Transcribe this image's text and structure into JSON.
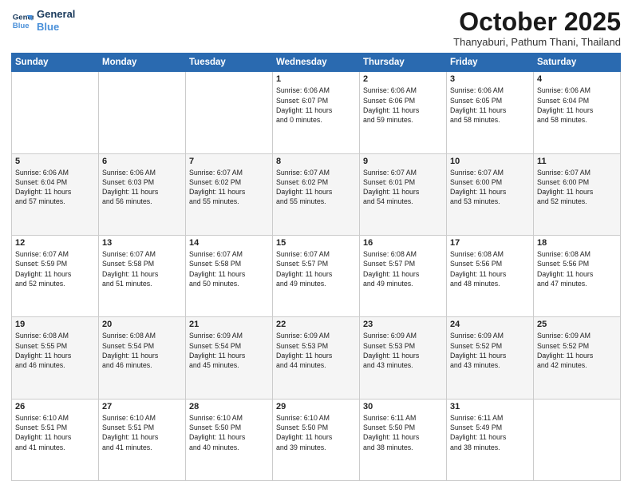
{
  "logo": {
    "line1": "General",
    "line2": "Blue"
  },
  "title": "October 2025",
  "location": "Thanyaburi, Pathum Thani, Thailand",
  "weekdays": [
    "Sunday",
    "Monday",
    "Tuesday",
    "Wednesday",
    "Thursday",
    "Friday",
    "Saturday"
  ],
  "weeks": [
    [
      {
        "day": "",
        "info": ""
      },
      {
        "day": "",
        "info": ""
      },
      {
        "day": "",
        "info": ""
      },
      {
        "day": "1",
        "info": "Sunrise: 6:06 AM\nSunset: 6:07 PM\nDaylight: 11 hours\nand 0 minutes."
      },
      {
        "day": "2",
        "info": "Sunrise: 6:06 AM\nSunset: 6:06 PM\nDaylight: 11 hours\nand 59 minutes."
      },
      {
        "day": "3",
        "info": "Sunrise: 6:06 AM\nSunset: 6:05 PM\nDaylight: 11 hours\nand 58 minutes."
      },
      {
        "day": "4",
        "info": "Sunrise: 6:06 AM\nSunset: 6:04 PM\nDaylight: 11 hours\nand 58 minutes."
      }
    ],
    [
      {
        "day": "5",
        "info": "Sunrise: 6:06 AM\nSunset: 6:04 PM\nDaylight: 11 hours\nand 57 minutes."
      },
      {
        "day": "6",
        "info": "Sunrise: 6:06 AM\nSunset: 6:03 PM\nDaylight: 11 hours\nand 56 minutes."
      },
      {
        "day": "7",
        "info": "Sunrise: 6:07 AM\nSunset: 6:02 PM\nDaylight: 11 hours\nand 55 minutes."
      },
      {
        "day": "8",
        "info": "Sunrise: 6:07 AM\nSunset: 6:02 PM\nDaylight: 11 hours\nand 55 minutes."
      },
      {
        "day": "9",
        "info": "Sunrise: 6:07 AM\nSunset: 6:01 PM\nDaylight: 11 hours\nand 54 minutes."
      },
      {
        "day": "10",
        "info": "Sunrise: 6:07 AM\nSunset: 6:00 PM\nDaylight: 11 hours\nand 53 minutes."
      },
      {
        "day": "11",
        "info": "Sunrise: 6:07 AM\nSunset: 6:00 PM\nDaylight: 11 hours\nand 52 minutes."
      }
    ],
    [
      {
        "day": "12",
        "info": "Sunrise: 6:07 AM\nSunset: 5:59 PM\nDaylight: 11 hours\nand 52 minutes."
      },
      {
        "day": "13",
        "info": "Sunrise: 6:07 AM\nSunset: 5:58 PM\nDaylight: 11 hours\nand 51 minutes."
      },
      {
        "day": "14",
        "info": "Sunrise: 6:07 AM\nSunset: 5:58 PM\nDaylight: 11 hours\nand 50 minutes."
      },
      {
        "day": "15",
        "info": "Sunrise: 6:07 AM\nSunset: 5:57 PM\nDaylight: 11 hours\nand 49 minutes."
      },
      {
        "day": "16",
        "info": "Sunrise: 6:08 AM\nSunset: 5:57 PM\nDaylight: 11 hours\nand 49 minutes."
      },
      {
        "day": "17",
        "info": "Sunrise: 6:08 AM\nSunset: 5:56 PM\nDaylight: 11 hours\nand 48 minutes."
      },
      {
        "day": "18",
        "info": "Sunrise: 6:08 AM\nSunset: 5:56 PM\nDaylight: 11 hours\nand 47 minutes."
      }
    ],
    [
      {
        "day": "19",
        "info": "Sunrise: 6:08 AM\nSunset: 5:55 PM\nDaylight: 11 hours\nand 46 minutes."
      },
      {
        "day": "20",
        "info": "Sunrise: 6:08 AM\nSunset: 5:54 PM\nDaylight: 11 hours\nand 46 minutes."
      },
      {
        "day": "21",
        "info": "Sunrise: 6:09 AM\nSunset: 5:54 PM\nDaylight: 11 hours\nand 45 minutes."
      },
      {
        "day": "22",
        "info": "Sunrise: 6:09 AM\nSunset: 5:53 PM\nDaylight: 11 hours\nand 44 minutes."
      },
      {
        "day": "23",
        "info": "Sunrise: 6:09 AM\nSunset: 5:53 PM\nDaylight: 11 hours\nand 43 minutes."
      },
      {
        "day": "24",
        "info": "Sunrise: 6:09 AM\nSunset: 5:52 PM\nDaylight: 11 hours\nand 43 minutes."
      },
      {
        "day": "25",
        "info": "Sunrise: 6:09 AM\nSunset: 5:52 PM\nDaylight: 11 hours\nand 42 minutes."
      }
    ],
    [
      {
        "day": "26",
        "info": "Sunrise: 6:10 AM\nSunset: 5:51 PM\nDaylight: 11 hours\nand 41 minutes."
      },
      {
        "day": "27",
        "info": "Sunrise: 6:10 AM\nSunset: 5:51 PM\nDaylight: 11 hours\nand 41 minutes."
      },
      {
        "day": "28",
        "info": "Sunrise: 6:10 AM\nSunset: 5:50 PM\nDaylight: 11 hours\nand 40 minutes."
      },
      {
        "day": "29",
        "info": "Sunrise: 6:10 AM\nSunset: 5:50 PM\nDaylight: 11 hours\nand 39 minutes."
      },
      {
        "day": "30",
        "info": "Sunrise: 6:11 AM\nSunset: 5:50 PM\nDaylight: 11 hours\nand 38 minutes."
      },
      {
        "day": "31",
        "info": "Sunrise: 6:11 AM\nSunset: 5:49 PM\nDaylight: 11 hours\nand 38 minutes."
      },
      {
        "day": "",
        "info": ""
      }
    ]
  ]
}
